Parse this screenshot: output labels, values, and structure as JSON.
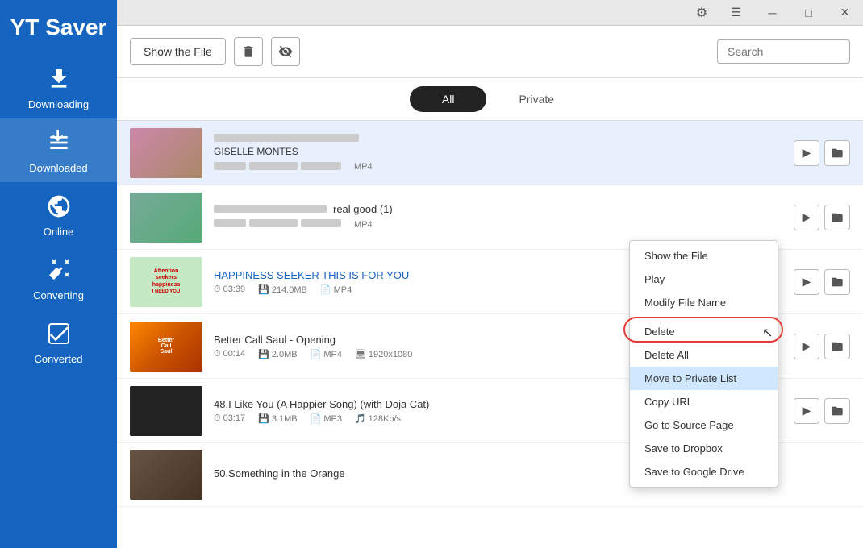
{
  "app": {
    "title": "YT Saver"
  },
  "titlebar": {
    "gear_label": "⚙",
    "menu_label": "☰",
    "minimize_label": "─",
    "maximize_label": "□",
    "close_label": "✕"
  },
  "toolbar": {
    "show_file_label": "Show the File",
    "delete_icon": "🗑",
    "settings_icon": "⊘",
    "search_placeholder": "Search"
  },
  "tabs": {
    "all_label": "All",
    "private_label": "Private"
  },
  "sidebar": {
    "items": [
      {
        "id": "downloading",
        "label": "Downloading"
      },
      {
        "id": "downloaded",
        "label": "Downloaded"
      },
      {
        "id": "online",
        "label": "Online"
      },
      {
        "id": "converting",
        "label": "Converting"
      },
      {
        "id": "converted",
        "label": "Converted"
      }
    ]
  },
  "items": [
    {
      "id": 1,
      "title_blurred": true,
      "author": "GISELLE MONTES",
      "format": "MP4",
      "thumb_type": "1"
    },
    {
      "id": 2,
      "title_suffix": "real good (1)",
      "title_blurred": true,
      "format": "MP4",
      "thumb_type": "2"
    },
    {
      "id": 3,
      "title": "HAPPINESS SEEKER THIS IS FOR YOU",
      "duration": "03:39",
      "size": "214.0MB",
      "format": "MP4",
      "thumb_type": "3"
    },
    {
      "id": 4,
      "title": "Better Call Saul - Opening",
      "duration": "00:14",
      "size": "2.0MB",
      "format": "MP4",
      "resolution": "1920x1080",
      "thumb_type": "4"
    },
    {
      "id": 5,
      "title": "48.I Like You (A Happier Song) (with Doja Cat)",
      "duration": "03:17",
      "size": "3.1MB",
      "format": "MP3",
      "bitrate": "128Kb/s",
      "thumb_type": "5"
    },
    {
      "id": 6,
      "title": "50.Something in the Orange",
      "thumb_type": "6"
    }
  ],
  "context_menu": {
    "items": [
      {
        "id": "show-file",
        "label": "Show the File",
        "divider_after": false
      },
      {
        "id": "play",
        "label": "Play",
        "divider_after": false
      },
      {
        "id": "modify-name",
        "label": "Modify File Name",
        "divider_after": true
      },
      {
        "id": "delete",
        "label": "Delete",
        "divider_after": false
      },
      {
        "id": "delete-all",
        "label": "Delete All",
        "divider_after": false
      },
      {
        "id": "move-private",
        "label": "Move to Private List",
        "highlighted": true,
        "divider_after": false
      },
      {
        "id": "copy-url",
        "label": "Copy URL",
        "divider_after": false
      },
      {
        "id": "goto-source",
        "label": "Go to Source Page",
        "divider_after": false
      },
      {
        "id": "save-dropbox",
        "label": "Save to Dropbox",
        "divider_after": false
      },
      {
        "id": "save-gdrive",
        "label": "Save to Google Drive",
        "divider_after": false
      }
    ]
  }
}
